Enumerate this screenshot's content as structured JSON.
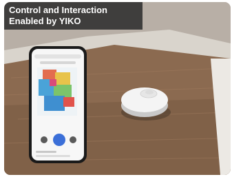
{
  "caption": {
    "line1": "Control and Interaction",
    "line2": "Enabled by YIKO"
  },
  "colors": {
    "caption_background": "#343434",
    "caption_text": "#ffffff",
    "table_wood": "#8e6a4f",
    "floor": "#d9d6d1",
    "robot_body": "#f2f2f2"
  },
  "icons": [
    "phone-image",
    "map-display",
    "robot-vacuum-image",
    "start-button-icon"
  ]
}
